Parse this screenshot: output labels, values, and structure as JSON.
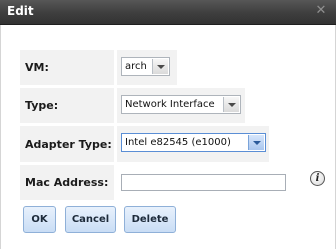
{
  "window": {
    "title": "Edit",
    "close_icon": "close-icon"
  },
  "form": {
    "vm": {
      "label": "VM:",
      "value": "arch"
    },
    "type": {
      "label": "Type:",
      "value": "Network Interface"
    },
    "adapter_type": {
      "label": "Adapter Type:",
      "value": "Intel e82545 (e1000)"
    },
    "mac_address": {
      "label": "Mac Address:",
      "value": "",
      "placeholder": ""
    },
    "info_icon": "info-icon"
  },
  "buttons": {
    "ok": "OK",
    "cancel": "Cancel",
    "delete": "Delete"
  },
  "colors": {
    "titlebar": "#3e3e3e",
    "button_bg": "#d3e3f7",
    "focused_border": "#5a8ed5"
  }
}
